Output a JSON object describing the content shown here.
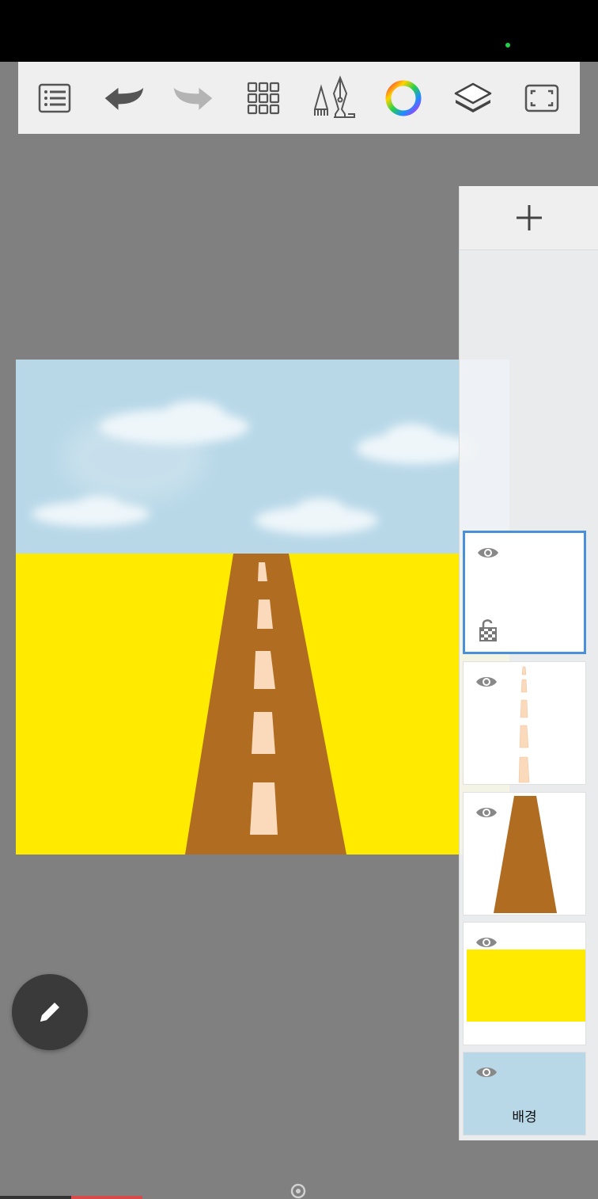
{
  "toolbar": {
    "items": [
      {
        "name": "menu-list",
        "icon": "list-icon"
      },
      {
        "name": "undo",
        "icon": "undo-icon"
      },
      {
        "name": "redo",
        "icon": "redo-icon"
      },
      {
        "name": "grid-tools",
        "icon": "grid-icon"
      },
      {
        "name": "brush",
        "icon": "pen-brush-icon"
      },
      {
        "name": "color",
        "icon": "color-wheel-icon"
      },
      {
        "name": "layers",
        "icon": "layers-icon"
      },
      {
        "name": "fullscreen",
        "icon": "fullscreen-icon"
      }
    ]
  },
  "colors": {
    "sky": "#b8d8e8",
    "field": "#ffea00",
    "road": "#b06c20",
    "road_marking": "#fbd9bb",
    "selection": "#4a90d9",
    "background_layer": "#b8d8e8"
  },
  "layers_panel": {
    "add_icon": "plus-icon",
    "layers": [
      {
        "id": "layer-5",
        "thumbnail": "empty",
        "visible": true,
        "selected": true,
        "locked_icon": "lock-open-icon"
      },
      {
        "id": "layer-4",
        "thumbnail": "road-markings",
        "visible": true,
        "selected": false
      },
      {
        "id": "layer-3",
        "thumbnail": "road",
        "visible": true,
        "selected": false
      },
      {
        "id": "layer-2",
        "thumbnail": "yellow-field",
        "visible": true,
        "selected": false
      },
      {
        "id": "layer-1",
        "thumbnail": "background",
        "visible": true,
        "selected": false,
        "label": "배경"
      }
    ]
  },
  "fab": {
    "icon": "pencil-icon"
  }
}
